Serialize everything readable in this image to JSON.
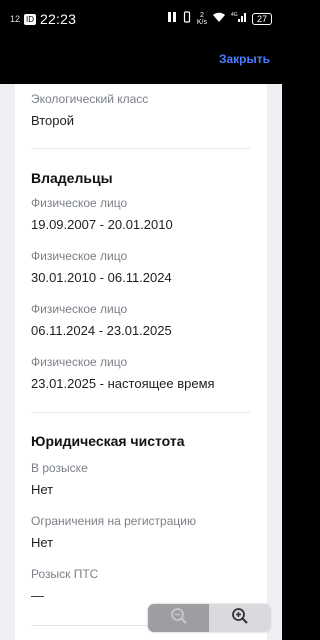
{
  "status_bar": {
    "notification_count": "12",
    "badge": "ID",
    "time": "22:23",
    "net_speed_value": "2",
    "net_speed_unit": "K/s",
    "network": "4G",
    "battery": "27"
  },
  "header": {
    "close_label": "Закрыть"
  },
  "eco_class": {
    "label": "Экологический класс",
    "value": "Второй"
  },
  "owners": {
    "title": "Владельцы",
    "items": [
      {
        "type": "Физическое лицо",
        "period": "19.09.2007 - 20.01.2010"
      },
      {
        "type": "Физическое лицо",
        "period": "30.01.2010 - 06.11.2024"
      },
      {
        "type": "Физическое лицо",
        "period": "06.11.2024 - 23.01.2025"
      },
      {
        "type": "Физическое лицо",
        "period": "23.01.2025 - настоящее время"
      }
    ]
  },
  "legal": {
    "title": "Юридическая чистота",
    "wanted": {
      "label": "В розыске",
      "value": "Нет"
    },
    "restrictions": {
      "label": "Ограничения на регистрацию",
      "value": "Нет"
    },
    "pts_wanted": {
      "label": "Розыск ПТС",
      "value": "—"
    }
  },
  "zoom_controls": {
    "zoom_out_icon": "magnifier-minus-icon",
    "zoom_in_icon": "magnifier-plus-icon"
  }
}
